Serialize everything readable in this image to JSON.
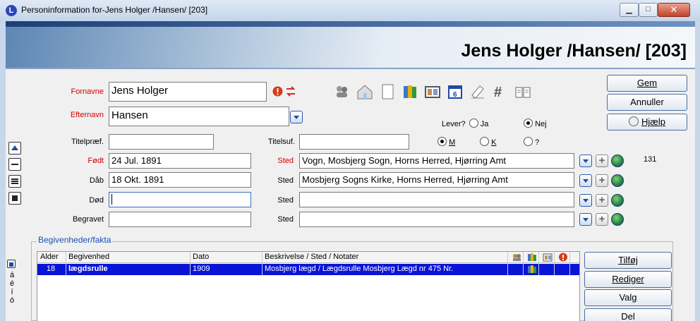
{
  "window": {
    "title": "Personinformation for-Jens Holger /Hansen/ [203]"
  },
  "heading": "Jens Holger /Hansen/ [203]",
  "form": {
    "fornavne_label": "Fornavne",
    "fornavne_value": "Jens Holger",
    "efternavn_label": "Efternavn",
    "efternavn_value": "Hansen",
    "titelpraef_label": "Titelpræf.",
    "titelsuf_label": "Titelsuf.",
    "foedt_label": "Født",
    "foedt_value": "24 Jul. 1891",
    "daab_label": "Dåb",
    "daab_value": "18 Okt. 1891",
    "doed_label": "Død",
    "doed_value": "",
    "begravet_label": "Begravet",
    "begravet_value": "",
    "sted_label": "Sted",
    "sted_foedt": "Vogn, Mosbjerg Sogn, Horns Herred, Hjørring Amt",
    "sted_daab": "Mosbjerg Sogns Kirke, Horns Herred, Hjørring Amt",
    "sted_doed": "",
    "sted_begravet": "",
    "count_label": "131"
  },
  "lever": {
    "label": "Lever?",
    "ja": "Ja",
    "nej": "Nej"
  },
  "sex": {
    "m": "M",
    "k": "K",
    "unknown": "?"
  },
  "buttons": {
    "gem": "Gem",
    "annuller": "Annuller",
    "hjaelp": "Hjælp",
    "tilfoej": "Tilføj",
    "rediger": "Rediger",
    "valg": "Valg",
    "del": "Del"
  },
  "events": {
    "group_title": "Begivenheder/fakta",
    "columns": [
      "Alder",
      "Begivenhed",
      "Dato",
      "Beskrivelse / Sted / Notater"
    ],
    "rows": [
      {
        "alder": "18",
        "begivenhed": "lægdsrulle",
        "dato": "1909",
        "beskrivelse": "Mosbjerg lægd / Lægdsrulle Mosbjerg Lægd nr 475  Nr."
      }
    ]
  },
  "side_letters": [
    "á",
    "é",
    "í",
    "ó"
  ]
}
